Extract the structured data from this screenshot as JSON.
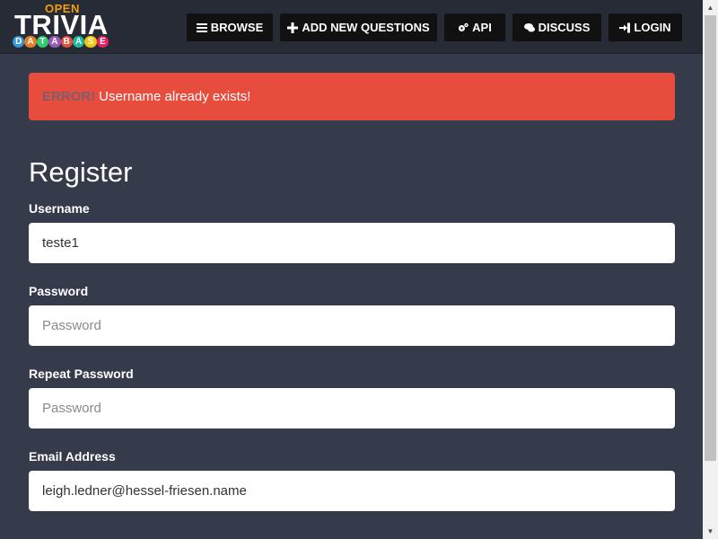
{
  "navbar": {
    "logo": {
      "open": "OPEN",
      "trivia": "TRIVIA",
      "database_letters": [
        "D",
        "A",
        "T",
        "A",
        "B",
        "A",
        "S",
        "E"
      ],
      "database_colors": [
        "#3498db",
        "#e67e22",
        "#2ecc71",
        "#9b59b6",
        "#e74c3c",
        "#1abc9c",
        "#f1c40f",
        "#e91e63"
      ]
    },
    "buttons": [
      {
        "label": "BROWSE",
        "icon": "list-icon"
      },
      {
        "label": "ADD NEW QUESTIONS",
        "icon": "plus-icon"
      },
      {
        "label": "API",
        "icon": "gears-icon"
      },
      {
        "label": "DISCUSS",
        "icon": "comments-icon"
      },
      {
        "label": "LOGIN",
        "icon": "sign-in-icon"
      }
    ]
  },
  "alert": {
    "prefix": "ERROR!",
    "message": "Username already exists!",
    "color": "#e74c3c"
  },
  "form": {
    "title": "Register",
    "username": {
      "label": "Username",
      "value": "teste1"
    },
    "password": {
      "label": "Password",
      "placeholder": "Password"
    },
    "repeat_password": {
      "label": "Repeat Password",
      "placeholder": "Password"
    },
    "email": {
      "label": "Email Address",
      "value": "leigh.ledner@hessel-friesen.name"
    }
  },
  "colors": {
    "background": "#363b4b",
    "navbar": "#272b35",
    "nav_button": "#111111"
  }
}
